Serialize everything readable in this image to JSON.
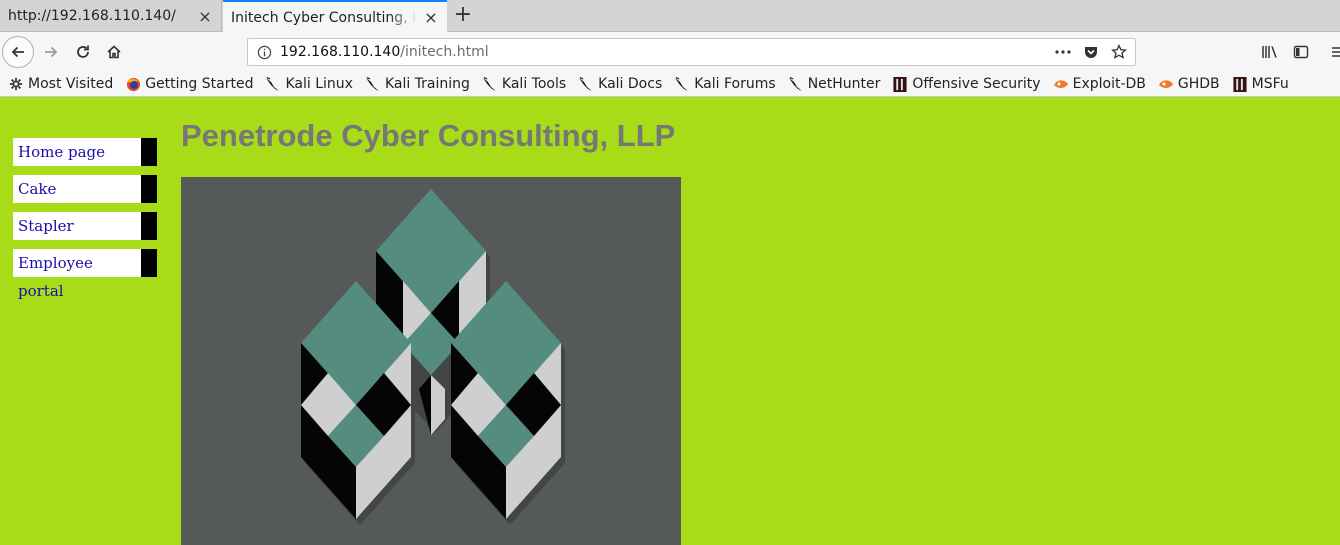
{
  "tabs": [
    {
      "title": "http://192.168.110.140/",
      "active": false
    },
    {
      "title": "Initech Cyber Consulting, LLP",
      "active": true
    }
  ],
  "new_tab_label": "+",
  "close_glyph": "×",
  "url": {
    "host": "192.168.110.140",
    "path": "/initech.html"
  },
  "bookmarks": [
    {
      "label": "Most Visited",
      "icon": "gear-icon"
    },
    {
      "label": "Getting Started",
      "icon": "firefox-icon"
    },
    {
      "label": "Kali Linux",
      "icon": "kali-dragon-icon"
    },
    {
      "label": "Kali Training",
      "icon": "kali-dragon-icon"
    },
    {
      "label": "Kali Tools",
      "icon": "kali-dragon-icon"
    },
    {
      "label": "Kali Docs",
      "icon": "kali-dragon-icon"
    },
    {
      "label": "Kali Forums",
      "icon": "kali-dragon-icon"
    },
    {
      "label": "NetHunter",
      "icon": "kali-dragon-icon"
    },
    {
      "label": "Offensive Security",
      "icon": "offsec-icon"
    },
    {
      "label": "Exploit-DB",
      "icon": "exploitdb-icon"
    },
    {
      "label": "GHDB",
      "icon": "exploitdb-icon"
    },
    {
      "label": "MSFu",
      "icon": "offsec-icon"
    }
  ],
  "page": {
    "title": "Penetrode Cyber Consulting, LLP",
    "nav": [
      "Home page",
      "Cake",
      "Stapler",
      "Employee portal"
    ]
  },
  "colors": {
    "page_background": "#a8dc18",
    "title_gray": "#777777",
    "logo_background": "#555a59",
    "logo_teal": "#548c80",
    "link_blue": "#1a0dab",
    "active_tab_accent": "#0a84ff"
  }
}
